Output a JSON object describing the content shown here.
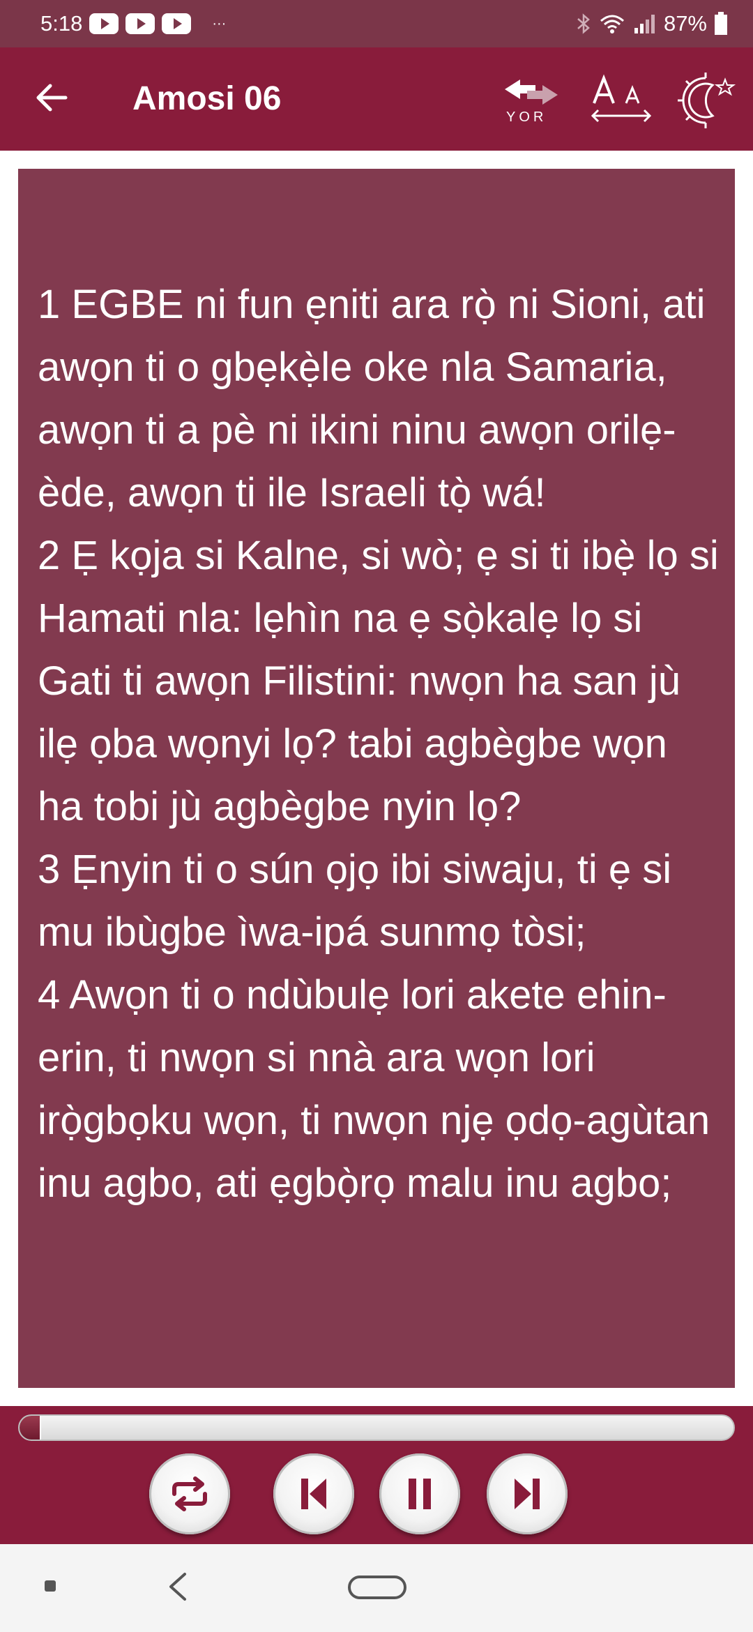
{
  "status": {
    "time": "5:18",
    "battery": "87%",
    "notification_icons": [
      "youtube-icon",
      "youtube-icon",
      "youtube-icon"
    ],
    "more_indicator": "···"
  },
  "app_bar": {
    "title": "Amosi 06",
    "lang_code": "YOR",
    "icons": [
      "back-arrow-icon",
      "language-swap-icon",
      "font-size-icon",
      "night-mode-icon"
    ]
  },
  "verses": [
    {
      "num": "1",
      "text": "EGBE ni fun ẹniti ara rọ̀ ni Sioni, ati awọn ti o gbẹkẹ̀le oke nla Samaria, awọn ti a pè ni ikini ninu awọn orilẹ-ède, awọn ti ile Israeli tọ̀ wá!"
    },
    {
      "num": "2",
      "text": "Ẹ kọja si Kalne, si wò; ẹ si ti ibẹ̀ lọ si Hamati nla: lẹhìn na ẹ sọ̀kalẹ lọ si Gati ti awọn Filistini: nwọn ha san jù ilẹ ọba wọnyi lọ? tabi agbègbe wọn ha tobi jù agbègbe nyin lọ?"
    },
    {
      "num": "3",
      "text": "Ẹnyin ti o sún ọjọ ibi siwaju, ti ẹ si mu ibùgbe ìwa-ipá sunmọ tòsi;"
    },
    {
      "num": "4",
      "text": "Awọn ti o ndùbulẹ lori akete ehin-erin, ti nwọn si nnà ara wọn lori irọ̀gbọku wọn, ti nwọn njẹ ọdọ-agùtan inu agbo, ati ẹgbọ̀rọ malu inu agbo;"
    }
  ],
  "player": {
    "progress": 0.03,
    "controls": [
      "repeat-icon",
      "skip-previous-icon",
      "pause-icon",
      "skip-next-icon"
    ]
  },
  "colors": {
    "status_bar": "#7b3649",
    "app_bar": "#891c3b",
    "text_panel": "#823a4f"
  }
}
